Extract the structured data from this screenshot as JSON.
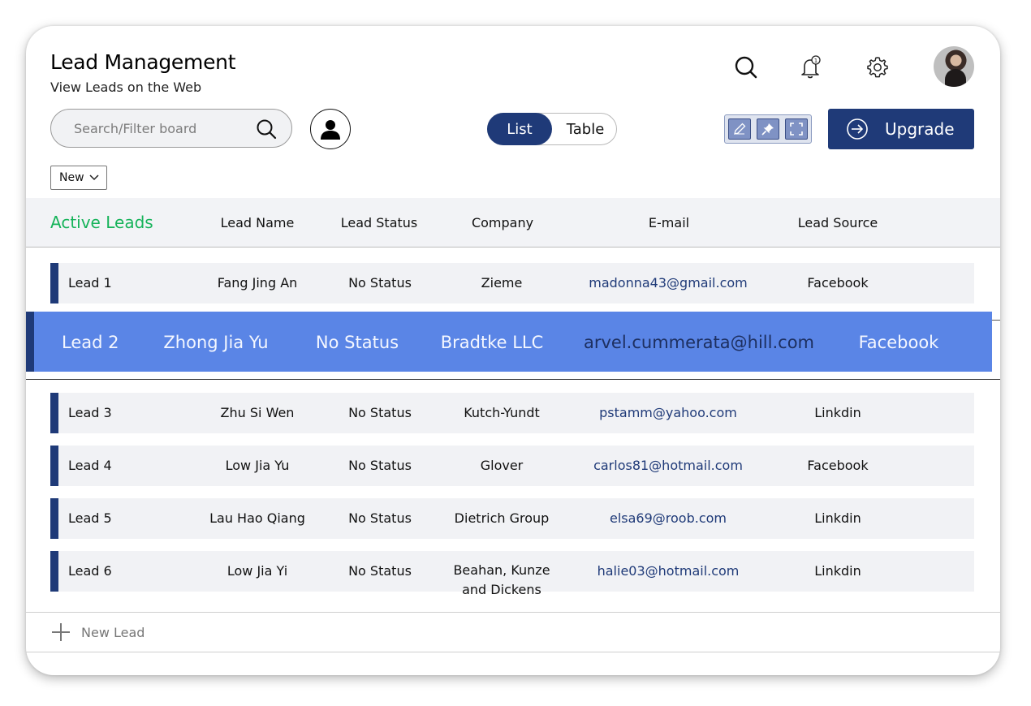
{
  "header": {
    "title": "Lead Management",
    "subtitle": "View Leads on the Web",
    "notification_count": "1"
  },
  "toolbar": {
    "search_placeholder": "Search/Filter board",
    "view_toggle": {
      "list_label": "List",
      "table_label": "Table",
      "selected": "List"
    },
    "tools": [
      "pencil-icon",
      "pin-icon",
      "fullscreen-icon"
    ],
    "upgrade_label": "Upgrade",
    "filter_dropdown": "New"
  },
  "table": {
    "group_label": "Active Leads",
    "columns": [
      "Lead Name",
      "Lead Status",
      "Company",
      "E-mail",
      "Lead Source"
    ],
    "rows": [
      {
        "lead": "Lead 1",
        "name": "Fang Jing An",
        "status": "No Status",
        "company": "Zieme",
        "email": "madonna43@gmail.com",
        "source": "Facebook"
      },
      {
        "lead": "Lead 2",
        "name": "Zhong Jia Yu",
        "status": "No Status",
        "company": "Bradtke LLC",
        "email": "arvel.cummerata@hill.com",
        "source": "Facebook"
      },
      {
        "lead": "Lead 3",
        "name": "Zhu Si Wen",
        "status": "No Status",
        "company": "Kutch-Yundt",
        "email": "pstamm@yahoo.com",
        "source": "Linkdin"
      },
      {
        "lead": "Lead 4",
        "name": "Low Jia Yu",
        "status": "No Status",
        "company": "Glover",
        "email": "carlos81@hotmail.com",
        "source": "Facebook"
      },
      {
        "lead": "Lead 5",
        "name": "Lau Hao Qiang",
        "status": "No Status",
        "company": "Dietrich Group",
        "email": "elsa69@roob.com",
        "source": "Linkdin"
      },
      {
        "lead": "Lead 6",
        "name": "Low Jia Yi",
        "status": "No Status",
        "company": "Beahan, Kunze and Dickens",
        "email": "halie03@hotmail.com",
        "source": "Linkdin"
      }
    ]
  },
  "footer": {
    "new_lead_label": "New Lead"
  },
  "colors": {
    "primary": "#1f3a78",
    "selected_row": "#5a85e6",
    "active_green": "#16b35a",
    "row_bg": "#f1f2f5"
  }
}
